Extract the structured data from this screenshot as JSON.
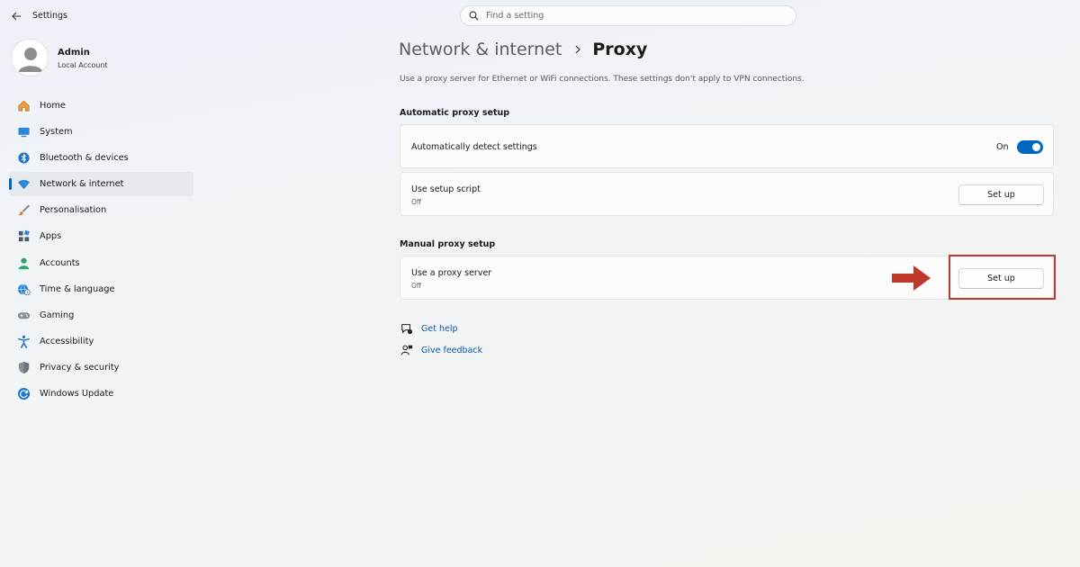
{
  "app": {
    "title": "Settings"
  },
  "search": {
    "placeholder": "Find a setting"
  },
  "profile": {
    "name": "Admin",
    "account_type": "Local Account"
  },
  "nav": {
    "items": [
      {
        "label": "Home",
        "icon": "home-icon",
        "color": "#d9822b"
      },
      {
        "label": "System",
        "icon": "system-icon",
        "color": "#2b88d8"
      },
      {
        "label": "Bluetooth & devices",
        "icon": "bluetooth-icon",
        "color": "#1e78d2"
      },
      {
        "label": "Network & internet",
        "icon": "wifi-icon",
        "color": "#2b88d8",
        "selected": true
      },
      {
        "label": "Personalisation",
        "icon": "brush-icon",
        "color": "#e07a3a"
      },
      {
        "label": "Apps",
        "icon": "apps-icon",
        "color": "#4a5a6e"
      },
      {
        "label": "Accounts",
        "icon": "accounts-icon",
        "color": "#2aa56e"
      },
      {
        "label": "Time & language",
        "icon": "globe-clock-icon",
        "color": "#2b88d8"
      },
      {
        "label": "Gaming",
        "icon": "gamepad-icon",
        "color": "#7a7f86"
      },
      {
        "label": "Accessibility",
        "icon": "accessibility-icon",
        "color": "#1e6fc8"
      },
      {
        "label": "Privacy & security",
        "icon": "shield-icon",
        "color": "#7a7f86"
      },
      {
        "label": "Windows Update",
        "icon": "update-icon",
        "color": "#1e78d2"
      }
    ]
  },
  "header": {
    "parent": "Network & internet",
    "current": "Proxy"
  },
  "description": "Use a proxy server for Ethernet or WiFi connections. These settings don't apply to VPN connections.",
  "automatic": {
    "title": "Automatic proxy setup",
    "detect": {
      "label": "Automatically detect settings",
      "state": "On"
    },
    "script": {
      "label": "Use setup script",
      "state": "Off",
      "button": "Set up"
    }
  },
  "manual": {
    "title": "Manual proxy setup",
    "proxy": {
      "label": "Use a proxy server",
      "state": "Off",
      "button": "Set up"
    }
  },
  "links": {
    "help": "Get help",
    "feedback": "Give feedback"
  },
  "colors": {
    "accent": "#0067c0",
    "annotation": "#c0392b",
    "link": "#0b5aa8"
  }
}
